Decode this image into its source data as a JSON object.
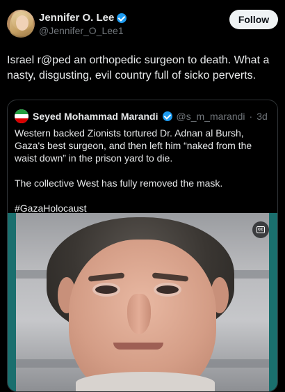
{
  "post": {
    "author_name": "Jennifer O. Lee",
    "author_handle": "@Jennifer_O_Lee1",
    "follow_label": "Follow",
    "text": "Israel r@ped an orthopedic surgeon to death. What a nasty, disgusting, evil country full of sicko perverts."
  },
  "quote": {
    "author_name": "Seyed Mohammad Marandi",
    "author_handle": "@s_m_marandi",
    "separator": "·",
    "time": "3d",
    "paragraphs": [
      "Western backed Zionists tortured Dr. Adnan al Bursh, Gaza's best surgeon, and then left him “naked from the waist down” in the prison yard to die.",
      "The collective West has fully removed the mask.",
      "#GazaHolocaust"
    ],
    "media_badge": "cc"
  },
  "colors": {
    "background": "#000000",
    "text_primary": "#e7e9ea",
    "text_secondary": "#71767b",
    "verified_blue": "#1d9bf0",
    "follow_button_bg": "#eff3f4",
    "border": "#2f3336"
  },
  "icons": {
    "verified": "verified-badge-icon",
    "media_badge": "closed-caption-icon"
  }
}
